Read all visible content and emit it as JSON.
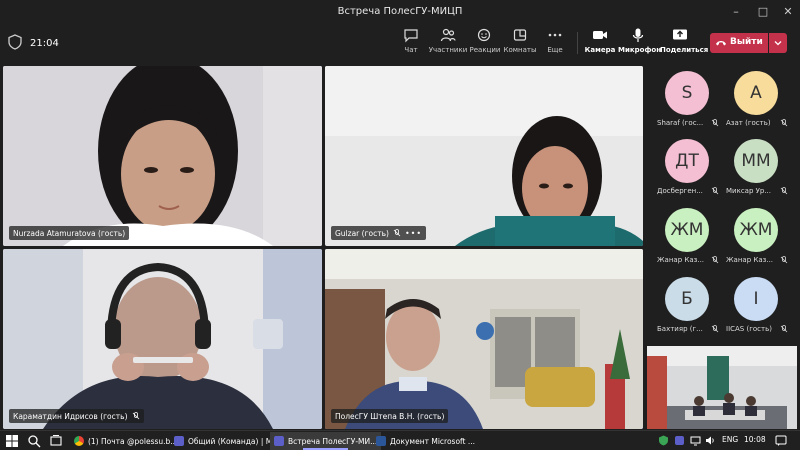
{
  "window": {
    "title": "Встреча ПолесГУ-МИЦП"
  },
  "toolbar": {
    "clock": "21:04",
    "chat": "Чат",
    "participants": "Участники",
    "reactions": "Реакции",
    "rooms": "Комнаты",
    "more": "Еще",
    "camera": "Камера",
    "mic": "Микрофон",
    "share": "Поделиться",
    "leave": "Выйти"
  },
  "tiles": [
    {
      "name": "Nurzada Atamuratova (гость)"
    },
    {
      "name": "Gulzar (гость)"
    },
    {
      "name": "Караматдин Идрисов (гость)"
    },
    {
      "name": "ПолесГУ Штепа В.Н. (гость)"
    }
  ],
  "roster": [
    {
      "initials": "S",
      "name": "Sharaf (гос...",
      "color": "#f4bfd2"
    },
    {
      "initials": "А",
      "name": "Азат (гость)",
      "color": "#f7dc9c"
    },
    {
      "initials": "ДТ",
      "name": "Досберген...",
      "color": "#f4bfd2"
    },
    {
      "initials": "ММ",
      "name": "Миксар Ур...",
      "color": "#c9dfc4"
    },
    {
      "initials": "ЖМ",
      "name": "Жанар Каз...",
      "color": "#c9f0c0"
    },
    {
      "initials": "ЖМ",
      "name": "Жанар Каз...",
      "color": "#c9f0c0"
    },
    {
      "initials": "Б",
      "name": "Бахтияр (г...",
      "color": "#c9dce8"
    },
    {
      "initials": "I",
      "name": "IICAS (гость)",
      "color": "#c9dcf4"
    }
  ],
  "taskbar": {
    "apps": [
      {
        "label": "(1) Почта @polessu.b..."
      },
      {
        "label": "Общий (Команда) | М..."
      },
      {
        "label": "Встреча ПолесГУ-МИ..."
      },
      {
        "label": "Документ Microsoft ..."
      }
    ],
    "lang": "ENG",
    "time": "10:08"
  }
}
